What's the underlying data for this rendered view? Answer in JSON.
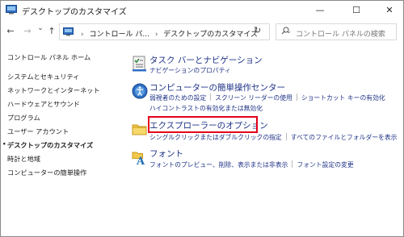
{
  "window": {
    "title": "デスクトップのカスタマイズ",
    "minimize": "—",
    "maximize": "☐",
    "close": "✕"
  },
  "nav": {
    "back": "←",
    "forward": "→",
    "recent": "⌄",
    "up": "↑",
    "dropdown": "⌄",
    "refresh": "↻"
  },
  "address": {
    "crumbs": [
      "コントロール パ...",
      "デスクトップのカスタマイズ"
    ],
    "separator": "›"
  },
  "search": {
    "placeholder": "コントロール パネルの検索"
  },
  "sidebar": {
    "items": [
      {
        "label": "コントロール パネル ホーム",
        "current": false
      },
      {
        "label": "システムとセキュリティ",
        "current": false
      },
      {
        "label": "ネットワークとインターネット",
        "current": false
      },
      {
        "label": "ハードウェアとサウンド",
        "current": false
      },
      {
        "label": "プログラム",
        "current": false
      },
      {
        "label": "ユーザー アカウント",
        "current": false
      },
      {
        "label": "デスクトップのカスタマイズ",
        "current": true
      },
      {
        "label": "時計と地域",
        "current": false
      },
      {
        "label": "コンピューターの簡単操作",
        "current": false
      }
    ]
  },
  "groups": [
    {
      "title": "タスク バーとナビゲーション",
      "icon": "taskbar-navigation-icon",
      "links": [
        [
          "ナビゲーションのプロパティ"
        ]
      ]
    },
    {
      "title": "コンピューターの簡単操作センター",
      "icon": "ease-of-access-icon",
      "links": [
        [
          "弱視者のための設定",
          "スクリーン リーダーの使用",
          "ショートカット キーの有効化"
        ],
        [
          "ハイコントラストの有効化または無効化"
        ]
      ]
    },
    {
      "title": "エクスプローラーのオプション",
      "icon": "folder-options-icon",
      "links": [
        [
          "シングルクリックまたはダブルクリックの指定",
          "すべてのファイルとフォルダーを表示"
        ]
      ]
    },
    {
      "title": "フォント",
      "icon": "fonts-icon",
      "links": [
        [
          "フォントのプレビュー、削除、表示または非表示",
          "フォント設定の変更"
        ]
      ]
    }
  ],
  "colors": {
    "link": "#1e3287",
    "highlight": "#e3001b"
  }
}
